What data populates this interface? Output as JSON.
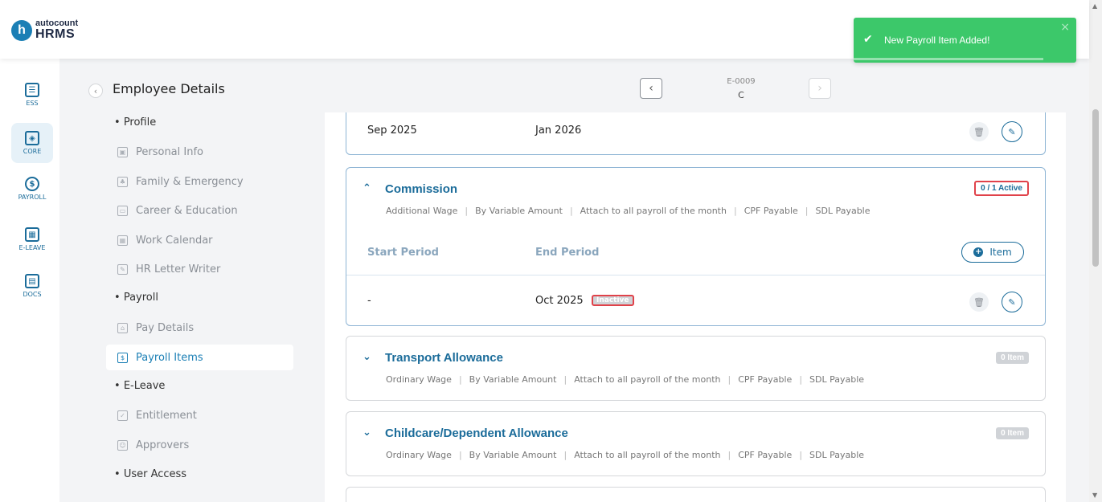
{
  "header": {
    "logo_letter": "h",
    "logo_top": "autocount",
    "logo_bottom": "HRMS"
  },
  "toast": {
    "message": "New Payroll Item Added!",
    "close": "×",
    "color": "#3cc86a"
  },
  "rail": {
    "items": [
      {
        "label": "ESS",
        "icon": "ess-icon"
      },
      {
        "label": "CORE",
        "icon": "core-icon"
      },
      {
        "label": "PAYROLL",
        "icon": "payroll-icon"
      },
      {
        "label": "E-LEAVE",
        "icon": "calendar-icon"
      },
      {
        "label": "DOCS",
        "icon": "docs-icon"
      }
    ],
    "active": "CORE"
  },
  "sidebar": {
    "title": "Employee Details",
    "groups": {
      "profile": "Profile",
      "payroll": "Payroll",
      "eleave": "E-Leave",
      "user_access": "User Access"
    },
    "items": {
      "personal_info": "Personal Info",
      "family": "Family & Emergency",
      "career": "Career & Education",
      "work_calendar": "Work Calendar",
      "hr_letter": "HR Letter Writer",
      "pay_details": "Pay Details",
      "payroll_items": "Payroll Items",
      "entitlement": "Entitlement",
      "approvers": "Approvers"
    },
    "active_item": "Payroll Items"
  },
  "pager": {
    "employee_code": "E-0009",
    "employee_name": "C"
  },
  "cards": {
    "top_card": {
      "start": "Sep 2025",
      "end": "Jan 2026"
    },
    "commission": {
      "title": "Commission",
      "tags": [
        "Additional Wage",
        "By Variable Amount",
        "Attach to all payroll of the month",
        "CPF Payable",
        "SDL Payable"
      ],
      "badge": "0 / 1 Active",
      "start_header": "Start Period",
      "end_header": "End Period",
      "item_button": "Item",
      "row_start": "-",
      "row_end": "Oct 2025",
      "row_status": "Inactive"
    },
    "transport": {
      "title": "Transport Allowance",
      "tags": [
        "Ordinary Wage",
        "By Variable Amount",
        "Attach to all payroll of the month",
        "CPF Payable",
        "SDL Payable"
      ],
      "badge": "0 Item"
    },
    "childcare": {
      "title": "Childcare/Dependent Allowance",
      "tags": [
        "Ordinary Wage",
        "By Variable Amount",
        "Attach to all payroll of the month",
        "CPF Payable",
        "SDL Payable"
      ],
      "badge": "0 Item"
    }
  },
  "colors": {
    "accent": "#1b6c9a",
    "highlight_border": "#e0424a"
  }
}
